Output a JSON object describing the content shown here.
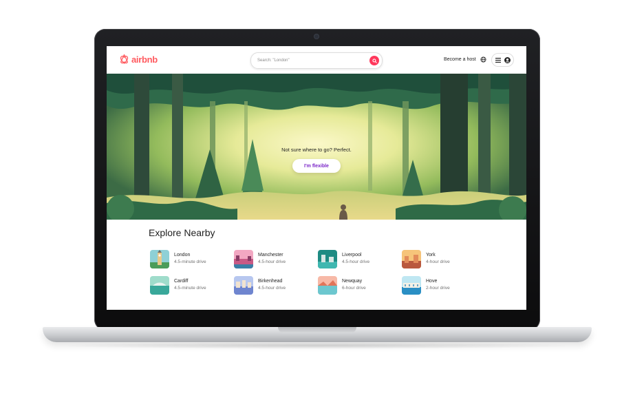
{
  "brand": {
    "name": "airbnb",
    "color": "#ff5a5f"
  },
  "header": {
    "search_placeholder": "Search: \"London\"",
    "search_icon": "search-icon",
    "become_host": "Become a host",
    "globe_icon": "globe-icon",
    "menu_icon": "hamburger-menu-icon",
    "user_icon": "user-avatar-icon"
  },
  "hero": {
    "tagline": "Not sure where to go? Perfect.",
    "cta_label": "I'm flexible",
    "cta_color": "#7a24c8"
  },
  "explore": {
    "title": "Explore Nearby",
    "places": [
      {
        "city": "London",
        "drive": "4.5-minute drive"
      },
      {
        "city": "Manchester",
        "drive": "4.5-hour drive"
      },
      {
        "city": "Liverpool",
        "drive": "4.5-hour drive"
      },
      {
        "city": "York",
        "drive": "4-hour drive"
      },
      {
        "city": "Cardiff",
        "drive": "4.5-minute drive"
      },
      {
        "city": "Birkenhead",
        "drive": "4.5-hour drive"
      },
      {
        "city": "Newquay",
        "drive": "6-hour drive"
      },
      {
        "city": "Hove",
        "drive": "2-hour drive"
      }
    ]
  }
}
